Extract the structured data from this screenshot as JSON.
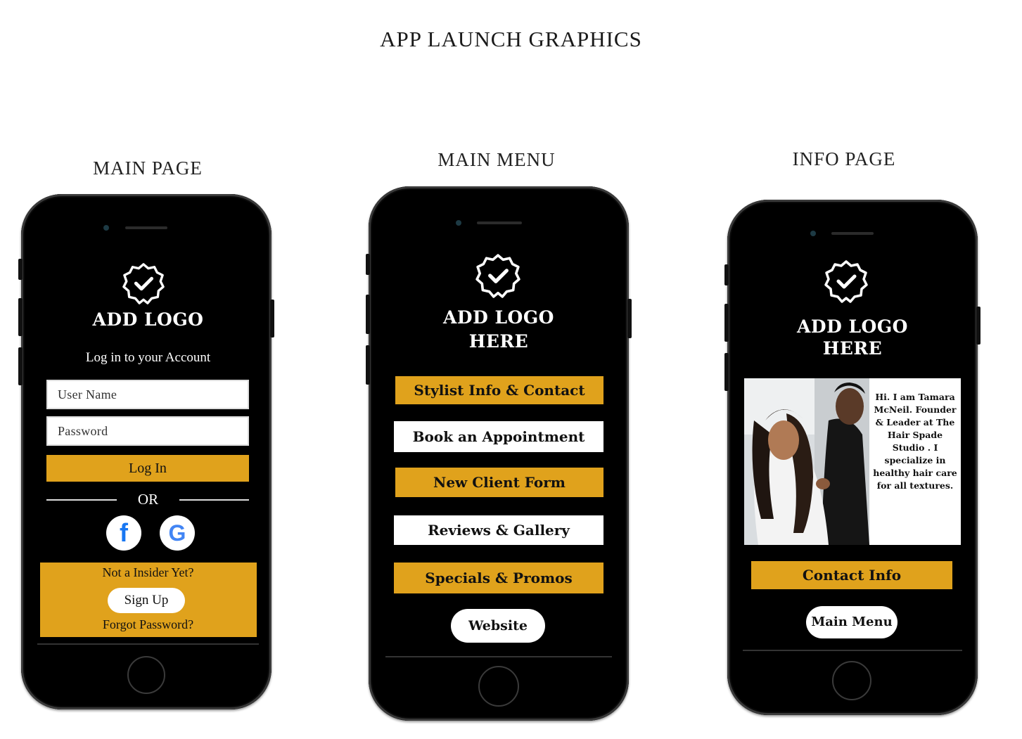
{
  "header": {
    "title": "APP LAUNCH GRAPHICS"
  },
  "screens": {
    "main_page": {
      "label": "MAIN PAGE",
      "logo": "ADD LOGO",
      "subtitle": "Log in to your Account",
      "username_placeholder": "User Name",
      "password_placeholder": "Password",
      "login_button": "Log In",
      "divider": "OR",
      "social": {
        "facebook": "f",
        "google": "G"
      },
      "not_insider": "Not a Insider Yet?",
      "signup_button": "Sign Up",
      "forgot_password": "Forgot Password?"
    },
    "main_menu": {
      "label": "MAIN MENU",
      "logo_line1": "ADD LOGO",
      "logo_line2": "HERE",
      "items": [
        "Stylist Info & Contact",
        "Book an Appointment",
        "New Client Form",
        "Reviews & Gallery",
        "Specials & Promos"
      ],
      "website_button": "Website"
    },
    "info_page": {
      "label": "INFO PAGE",
      "logo_line1": "ADD LOGO",
      "logo_line2": "HERE",
      "bio": "Hi. I am Tamara McNeil. Founder & Leader at The Hair Spade Studio . I specialize in healthy hair care for all textures.",
      "contact_button": "Contact Info",
      "main_menu_button": "Main Menu"
    }
  },
  "colors": {
    "gold": "#e0a21c",
    "phone": "#000000",
    "facebook": "#1877f2"
  },
  "icons": {
    "badge": "verified-badge-icon",
    "facebook": "facebook-icon",
    "google": "google-icon"
  }
}
